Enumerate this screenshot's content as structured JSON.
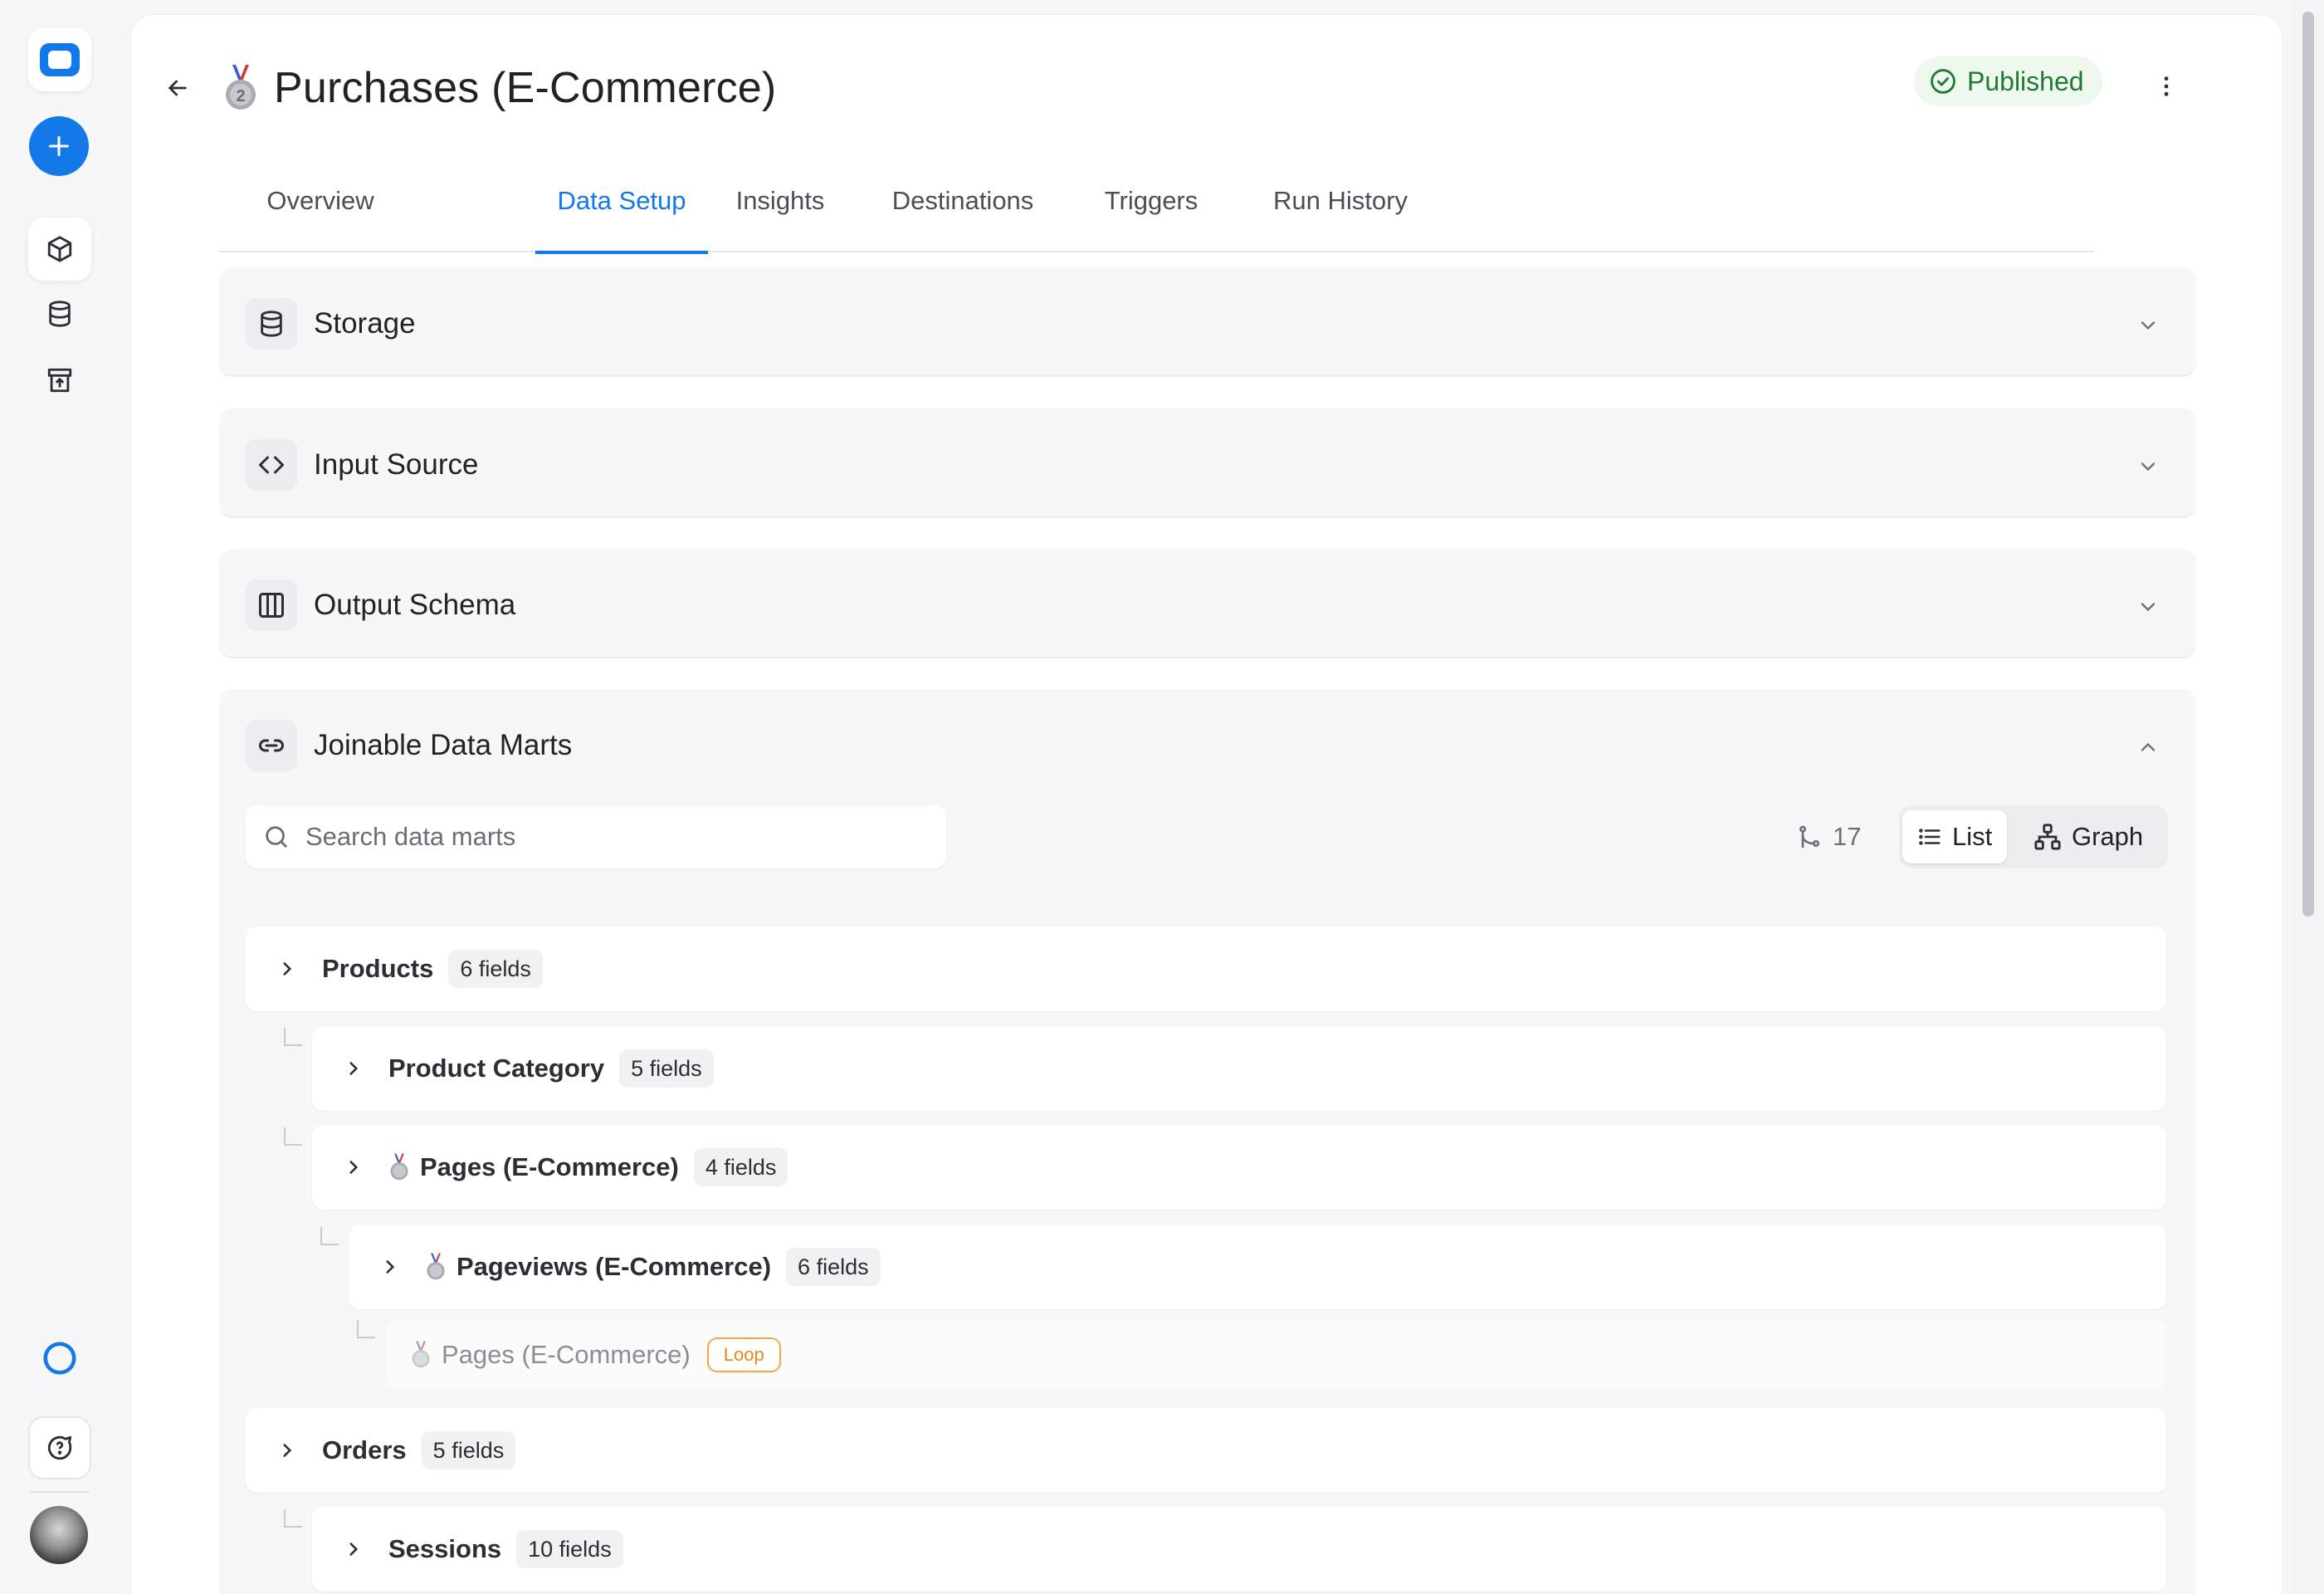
{
  "header": {
    "title": "Purchases (E-Commerce)",
    "status": "Published"
  },
  "tabs": [
    {
      "label": "Overview"
    },
    {
      "label": "Data Setup"
    },
    {
      "label": "Insights"
    },
    {
      "label": "Destinations"
    },
    {
      "label": "Triggers"
    },
    {
      "label": "Run History"
    }
  ],
  "active_tab": "Data Setup",
  "sections": {
    "storage": "Storage",
    "input_source": "Input Source",
    "output_schema": "Output Schema",
    "joinable": "Joinable Data Marts"
  },
  "joinable": {
    "search_placeholder": "Search data marts",
    "relation_count": "17",
    "view_list": "List",
    "view_graph": "Graph",
    "rows": [
      {
        "name": "Products",
        "fields": "6 fields"
      },
      {
        "name": "Product Category",
        "fields": "5 fields"
      },
      {
        "name": "Pages (E-Commerce)",
        "fields": "4 fields"
      },
      {
        "name": "Pageviews (E-Commerce)",
        "fields": "6 fields"
      },
      {
        "name": "Pages (E-Commerce)",
        "badge": "Loop"
      },
      {
        "name": "Orders",
        "fields": "5 fields"
      },
      {
        "name": "Sessions",
        "fields": "10 fields"
      }
    ]
  },
  "colors": {
    "accent": "#1479e8",
    "published_bg": "#eef8ef",
    "published_text": "#1f7a34",
    "loop": "#f5a742"
  },
  "icons": [
    "app-logo-icon",
    "plus-icon",
    "box-icon",
    "database-icon",
    "archive-upload-icon",
    "status-ring-icon",
    "chat-help-icon",
    "avatar",
    "arrow-left-icon",
    "medal-icon",
    "check-circle-icon",
    "more-vertical-icon",
    "chevron-down-icon",
    "chevron-up-icon",
    "chevron-right-icon",
    "code-icon",
    "columns-icon",
    "link-icon",
    "search-icon",
    "git-branch-icon",
    "list-icon",
    "graph-icon"
  ]
}
